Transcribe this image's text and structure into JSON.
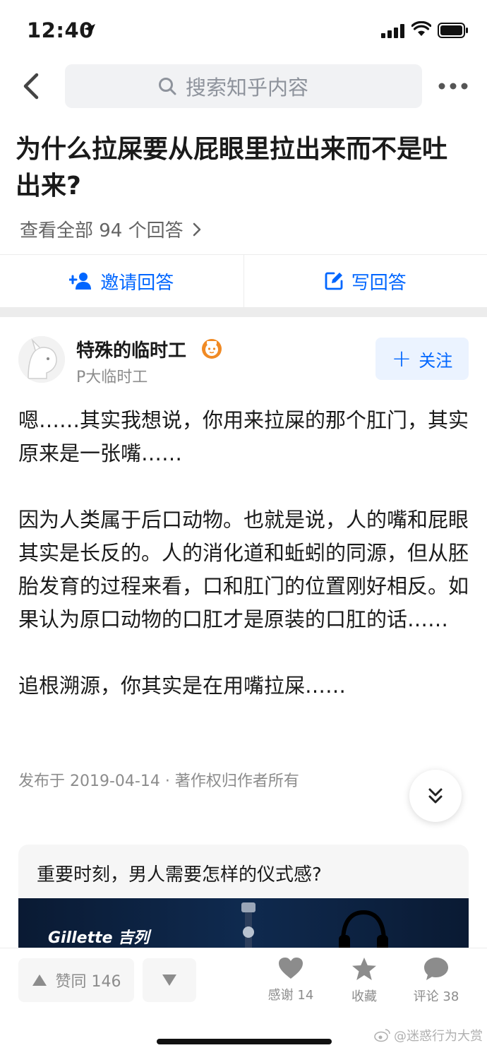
{
  "status_bar": {
    "time": "12:40"
  },
  "search": {
    "placeholder": "搜索知乎内容"
  },
  "question": {
    "title": "为什么拉屎要从屁眼里拉出来而不是吐出来?",
    "view_all": "查看全部 94 个回答"
  },
  "actions": {
    "invite": "邀请回答",
    "write": "写回答"
  },
  "author": {
    "name": "特殊的临时工",
    "description": "P大临时工",
    "follow": "关注"
  },
  "answer": {
    "paragraphs": [
      "嗯……其实我想说，你用来拉屎的那个肛门，其实原来是一张嘴……",
      "因为人类属于后口动物。也就是说，人的嘴和屁眼其实是长反的。人的消化道和蚯蚓的同源，但从胚胎发育的过程来看，口和肛门的位置刚好相反。如果认为原口动物的口肛才是原装的口肛的话……",
      "追根溯源，你其实是在用嘴拉屎……"
    ],
    "meta": "发布于 2019-04-14 · 著作权归作者所有"
  },
  "ad": {
    "title": "重要时刻，男人需要怎样的仪式感?",
    "brand": "Gillette 吉列"
  },
  "bottom_bar": {
    "upvote": "赞同 146",
    "thanks": "感谢 14",
    "favorite": "收藏",
    "comment": "评论 38"
  },
  "watermark": "@迷惑行为大赏",
  "colors": {
    "accent": "#0066ff",
    "follow_bg": "#ebf3ff",
    "badge": "#f08a24"
  },
  "icons": [
    "location-arrow-icon",
    "signal-icon",
    "wifi-icon",
    "battery-icon",
    "back-icon",
    "search-icon",
    "more-icon",
    "chevron-right-icon",
    "add-person-icon",
    "edit-icon",
    "badge-icon",
    "plus-icon",
    "double-chevron-down-icon",
    "upvote-icon",
    "downvote-icon",
    "heart-icon",
    "star-icon",
    "comment-icon",
    "weibo-icon"
  ]
}
